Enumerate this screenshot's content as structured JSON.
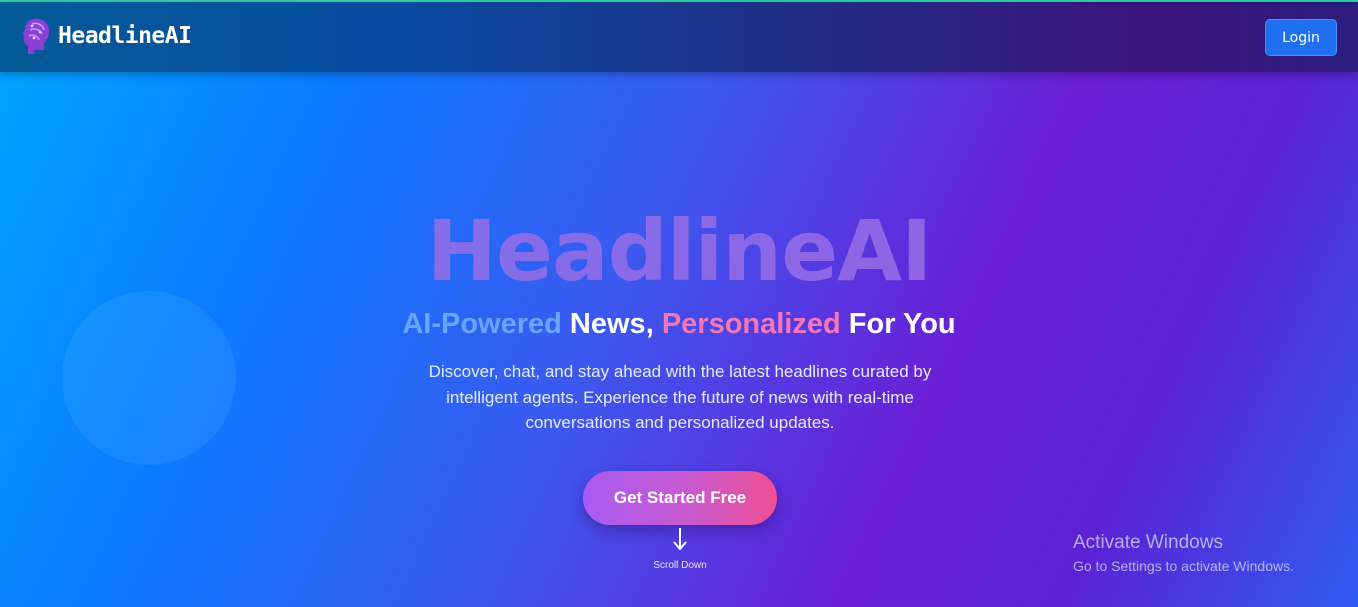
{
  "header": {
    "logo_text": "HeadlineAI",
    "login_label": "Login"
  },
  "hero": {
    "big_title": "HeadlineAI",
    "tagline": {
      "part1": "AI-Powered",
      "part2": " News, ",
      "part3": "Personalized",
      "part4": " For You"
    },
    "subtitle": "Discover, chat, and stay ahead with the latest headlines curated by intelligent agents. Experience the future of news with real-time conversations and personalized updates.",
    "cta_label": "Get Started Free",
    "scroll_label": "Scroll Down"
  },
  "watermark": {
    "title": "Activate Windows",
    "subtitle": "Go to Settings to activate Windows."
  },
  "icons": {
    "logo": "brain-head-icon",
    "scroll": "arrow-down-icon"
  },
  "colors": {
    "accent_blue": "#66a6ff",
    "accent_pink": "#f576b4",
    "login_button": "#1f6ff0",
    "cta_gradient_start": "#a85bf2",
    "cta_gradient_end": "#ee4f93"
  }
}
